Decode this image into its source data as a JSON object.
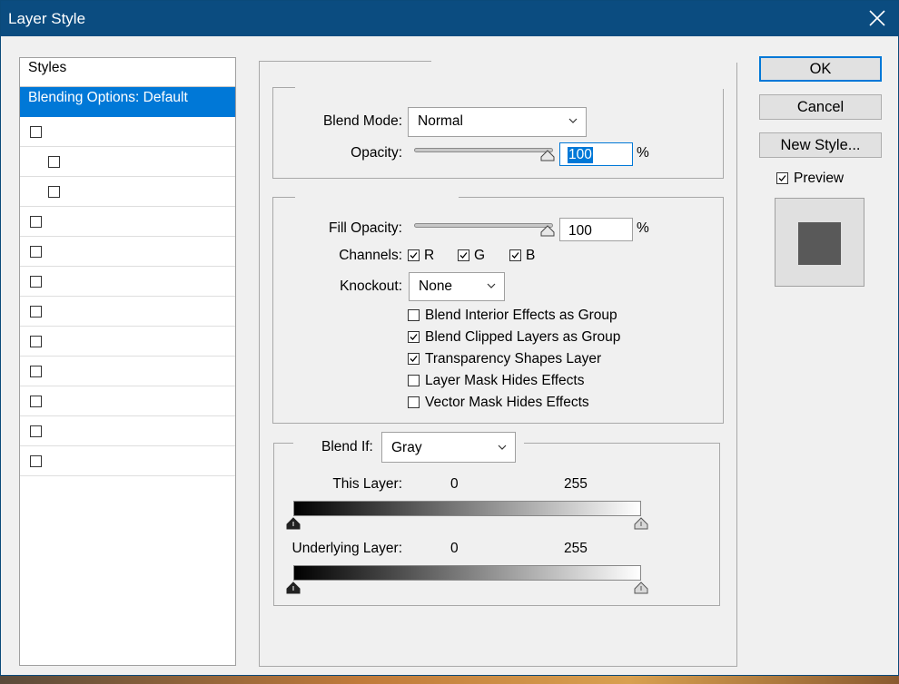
{
  "window": {
    "title": "Layer Style"
  },
  "styles_panel": {
    "header": "Styles",
    "selected_item": "Blending Options: Default",
    "style_checkboxes": [
      {
        "checked": false,
        "indent": false
      },
      {
        "checked": false,
        "indent": true
      },
      {
        "checked": false,
        "indent": true
      },
      {
        "checked": false,
        "indent": false
      },
      {
        "checked": false,
        "indent": false
      },
      {
        "checked": false,
        "indent": false
      },
      {
        "checked": false,
        "indent": false
      },
      {
        "checked": false,
        "indent": false
      },
      {
        "checked": false,
        "indent": false
      },
      {
        "checked": false,
        "indent": false
      },
      {
        "checked": false,
        "indent": false
      },
      {
        "checked": false,
        "indent": false
      }
    ]
  },
  "general_blending": {
    "blend_mode_label": "Blend Mode:",
    "blend_mode_value": "Normal",
    "opacity_label": "Opacity:",
    "opacity_value": "100",
    "opacity_unit": "%",
    "opacity_level": 1.0
  },
  "advanced_blending": {
    "fill_opacity_label": "Fill Opacity:",
    "fill_opacity_value": "100",
    "fill_opacity_unit": "%",
    "fill_opacity_level": 1.0,
    "channels_label": "Channels:",
    "channels": [
      {
        "label": "R",
        "checked": true
      },
      {
        "label": "G",
        "checked": true
      },
      {
        "label": "B",
        "checked": true
      }
    ],
    "knockout_label": "Knockout:",
    "knockout_value": "None",
    "options": [
      {
        "label": "Blend Interior Effects as Group",
        "checked": false
      },
      {
        "label": "Blend Clipped Layers as Group",
        "checked": true
      },
      {
        "label": "Transparency Shapes Layer",
        "checked": true
      },
      {
        "label": "Layer Mask Hides Effects",
        "checked": false
      },
      {
        "label": "Vector Mask Hides Effects",
        "checked": false
      }
    ]
  },
  "blend_if": {
    "label": "Blend If:",
    "value": "Gray",
    "this_layer": {
      "label": "This Layer:",
      "min": "0",
      "max": "255"
    },
    "underlying_layer": {
      "label": "Underlying Layer:",
      "min": "0",
      "max": "255"
    }
  },
  "buttons": {
    "ok": "OK",
    "cancel": "Cancel",
    "new_style": "New Style..."
  },
  "preview": {
    "label": "Preview",
    "checked": true,
    "swatch_color": "#595959"
  },
  "colors": {
    "accent": "#0078d7",
    "titlebar": "#0b4c80"
  }
}
